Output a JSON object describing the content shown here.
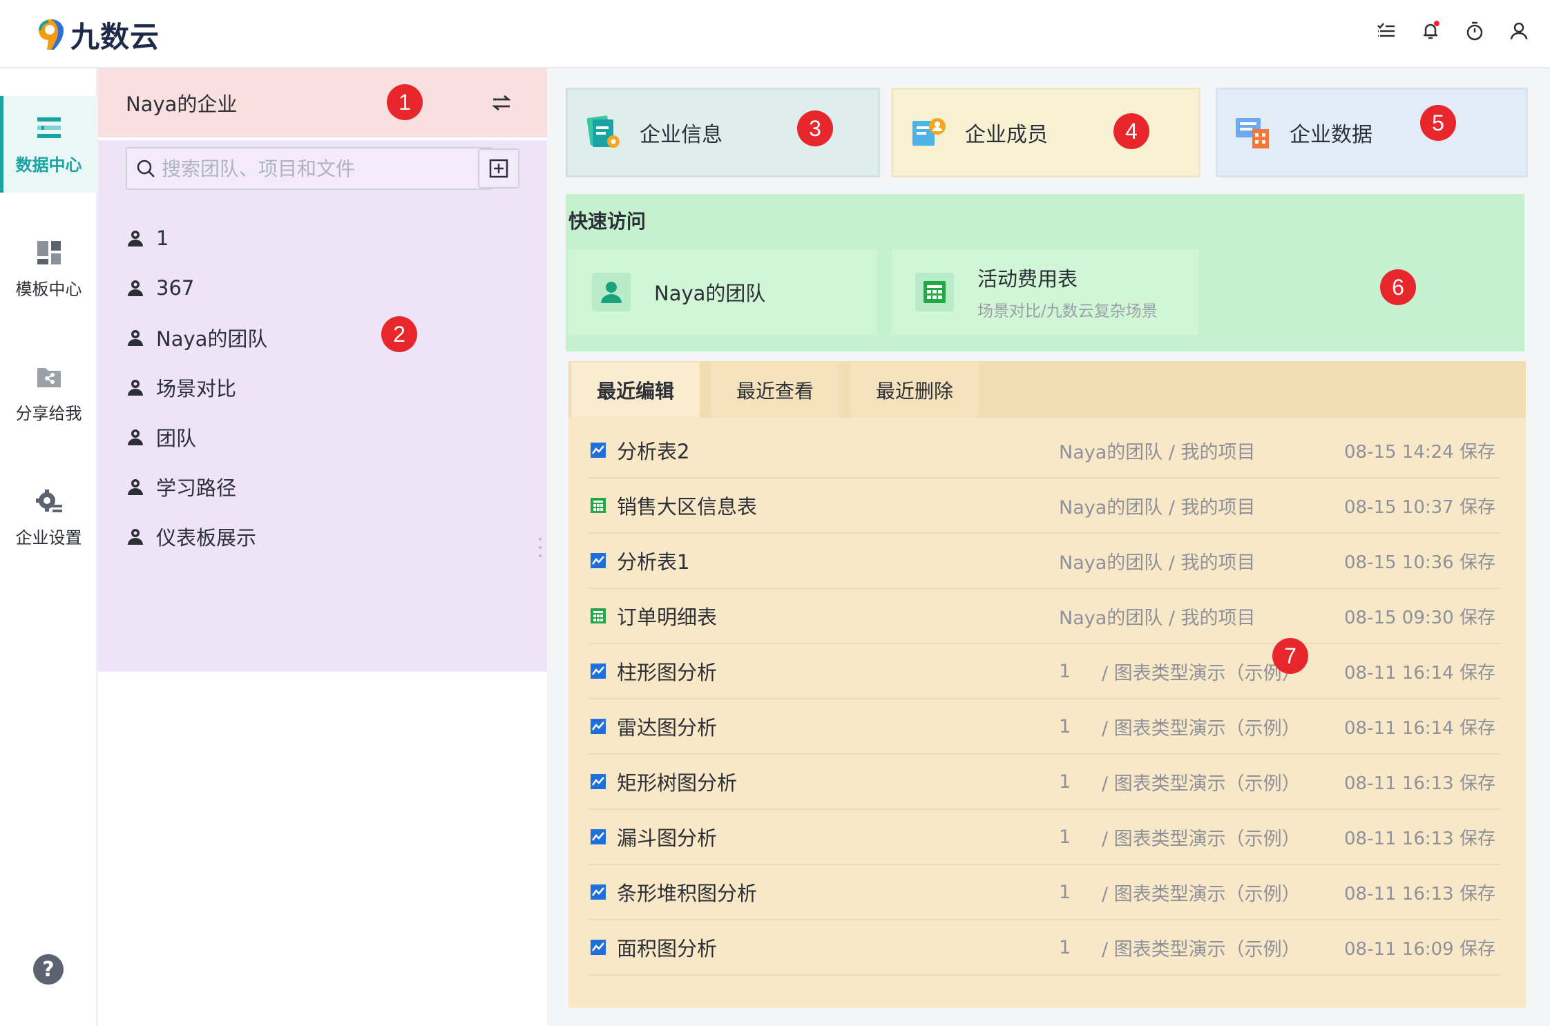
{
  "app": {
    "logo_text": "九数云"
  },
  "topbar": {
    "icons": [
      "task-list-icon",
      "bell-icon",
      "timer-icon",
      "user-icon"
    ],
    "notification_dot_color": "#f5222d"
  },
  "nav": {
    "items": [
      {
        "label": "数据中心",
        "icon": "data-center-icon",
        "active": true
      },
      {
        "label": "模板中心",
        "icon": "template-center-icon",
        "active": false
      },
      {
        "label": "分享给我",
        "icon": "shared-folder-icon",
        "active": false
      },
      {
        "label": "企业设置",
        "icon": "settings-gear-icon",
        "active": false
      }
    ],
    "help_label": "?"
  },
  "org": {
    "name": "Naya的企业"
  },
  "search": {
    "placeholder": "搜索团队、项目和文件"
  },
  "teams": [
    "1",
    "367",
    "Naya的团队",
    "场景对比",
    "团队",
    "学习路径",
    "仪表板展示"
  ],
  "cards": [
    {
      "label": "企业信息",
      "icon": "enterprise-info-icon"
    },
    {
      "label": "企业成员",
      "icon": "enterprise-members-icon"
    },
    {
      "label": "企业数据",
      "icon": "enterprise-data-icon"
    }
  ],
  "quick_access": {
    "title": "快速访问",
    "items": [
      {
        "title": "Naya的团队",
        "subtitle": "",
        "icon": "team-icon"
      },
      {
        "title": "活动费用表",
        "subtitle": "场景对比/九数云复杂场景",
        "icon": "spreadsheet-icon"
      }
    ]
  },
  "recent": {
    "tabs": [
      "最近编辑",
      "最近查看",
      "最近删除"
    ],
    "active_tab": 0,
    "rows": [
      {
        "name": "分析表2",
        "type": "analysis",
        "team": "",
        "path": "Naya的团队 / 我的项目",
        "time": "08-15 14:24 保存"
      },
      {
        "name": "销售大区信息表",
        "type": "sheet",
        "team": "",
        "path": "Naya的团队 / 我的项目",
        "time": "08-15 10:37 保存"
      },
      {
        "name": "分析表1",
        "type": "analysis",
        "team": "",
        "path": "Naya的团队 / 我的项目",
        "time": "08-15 10:36 保存"
      },
      {
        "name": "订单明细表",
        "type": "sheet",
        "team": "",
        "path": "Naya的团队 / 我的项目",
        "time": "08-15 09:30 保存"
      },
      {
        "name": "柱形图分析",
        "type": "analysis",
        "team": "1",
        "path": "/ 图表类型演示（示例）",
        "time": "08-11 16:14 保存"
      },
      {
        "name": "雷达图分析",
        "type": "analysis",
        "team": "1",
        "path": "/ 图表类型演示（示例）",
        "time": "08-11 16:14 保存"
      },
      {
        "name": "矩形树图分析",
        "type": "analysis",
        "team": "1",
        "path": "/ 图表类型演示（示例）",
        "time": "08-11 16:13 保存"
      },
      {
        "name": "漏斗图分析",
        "type": "analysis",
        "team": "1",
        "path": "/ 图表类型演示（示例）",
        "time": "08-11 16:13 保存"
      },
      {
        "name": "条形堆积图分析",
        "type": "analysis",
        "team": "1",
        "path": "/ 图表类型演示（示例）",
        "time": "08-11 16:13 保存"
      },
      {
        "name": "面积图分析",
        "type": "analysis",
        "team": "1",
        "path": "/ 图表类型演示（示例）",
        "time": "08-11 16:09 保存"
      }
    ]
  },
  "markers": [
    "1",
    "2",
    "3",
    "4",
    "5",
    "6",
    "7"
  ],
  "colors": {
    "accent": "#1aa3a3",
    "marker": "#e8272c",
    "analysis_icon": "#1e6fd9",
    "sheet_icon": "#22a845"
  }
}
